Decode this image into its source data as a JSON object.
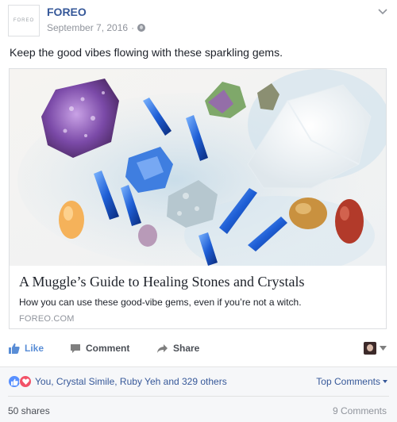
{
  "post": {
    "page_name": "FOREO",
    "avatar_text": "FOREO",
    "date": "September 7, 2016",
    "separator": "·",
    "privacy_icon": "globe-icon",
    "options_icon": "chevron-down-icon",
    "text": "Keep the good vibes flowing with these sparkling gems."
  },
  "link_card": {
    "image_description_icon": "crystals-photo",
    "title": "A Muggle’s Guide to Healing Stones and Crystals",
    "description": "How you can use these good-vibe gems, even if you’re not a witch.",
    "domain": "FOREO.COM"
  },
  "actions": {
    "like_label": "Like",
    "comment_label": "Comment",
    "share_label": "Share"
  },
  "summary": {
    "reactions_text": "You, Crystal Simile, Ruby Yeh and 329 others",
    "top_comments_label": "Top Comments",
    "shares_text": "50 shares",
    "comments_text": "9 Comments"
  },
  "colors": {
    "link_blue": "#365899",
    "like_blue": "#598dd6",
    "love_red": "#f25268",
    "reaction_like_blue": "#5890ff"
  }
}
